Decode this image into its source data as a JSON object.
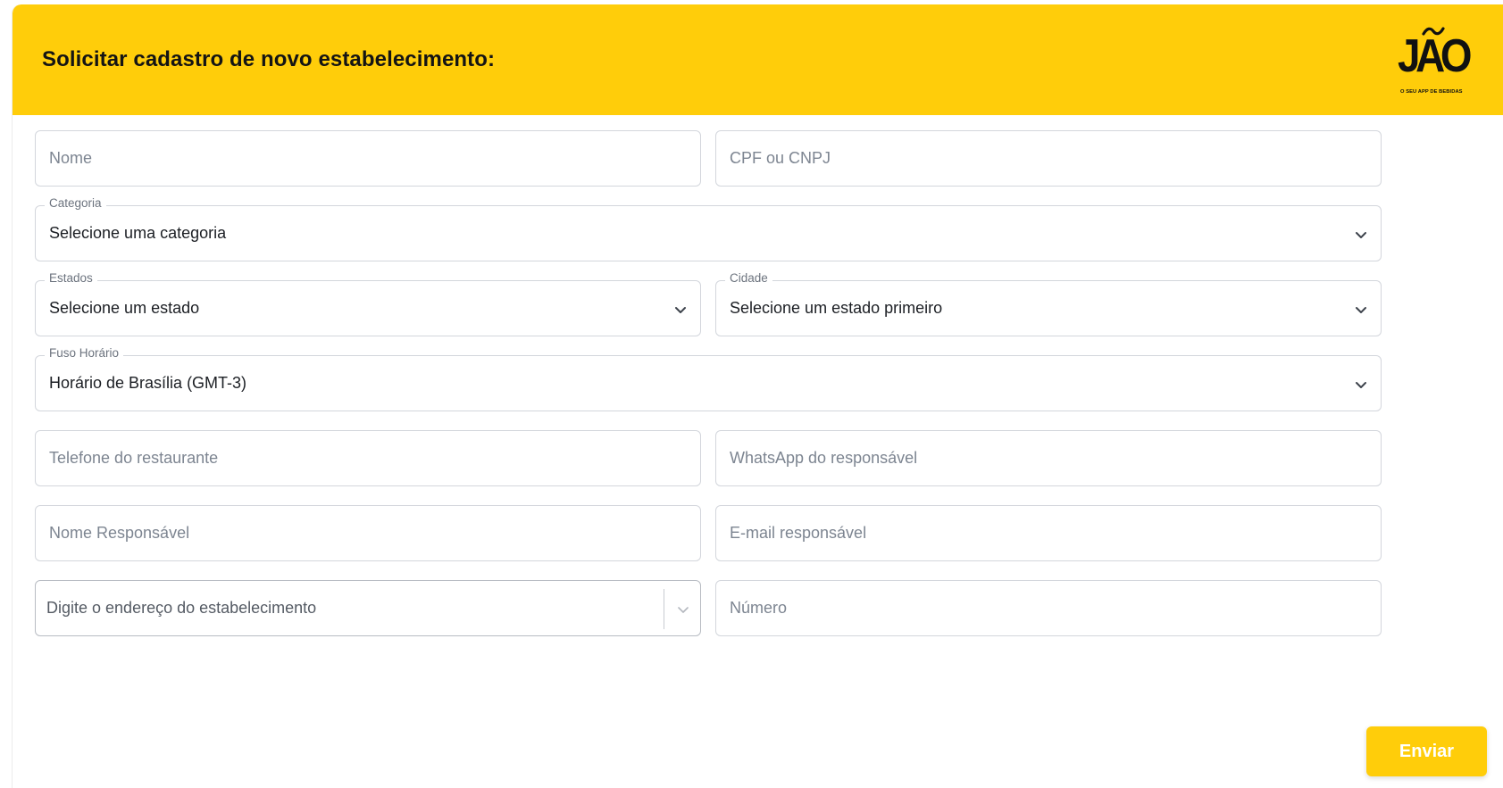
{
  "header": {
    "title": "Solicitar cadastro de novo estabelecimento:",
    "background_color": "#ffcd0a",
    "logo": {
      "word": "JÃO",
      "tagline": "O SEU APP DE BEBIDAS"
    }
  },
  "form": {
    "nome": {
      "placeholder": "Nome"
    },
    "cpf_cnpj": {
      "placeholder": "CPF ou CNPJ"
    },
    "categoria": {
      "label": "Categoria",
      "value": "Selecione uma categoria"
    },
    "estados": {
      "label": "Estados",
      "value": "Selecione um estado"
    },
    "cidade": {
      "label": "Cidade",
      "value": "Selecione um estado primeiro"
    },
    "fuso_horario": {
      "label": "Fuso Horário",
      "value": "Horário de Brasília (GMT-3)"
    },
    "telefone": {
      "placeholder": "Telefone do restaurante"
    },
    "whatsapp": {
      "placeholder": "WhatsApp do responsável"
    },
    "nome_responsavel": {
      "placeholder": "Nome Responsável"
    },
    "email_responsavel": {
      "placeholder": "E-mail responsável"
    },
    "endereco": {
      "placeholder": "Digite o endereço do estabelecimento"
    },
    "numero": {
      "placeholder": "Número"
    },
    "submit_label": "Enviar"
  },
  "icons": {
    "select_chevron": "chevron-down-icon",
    "brand_accent": "#ffcd0a"
  }
}
